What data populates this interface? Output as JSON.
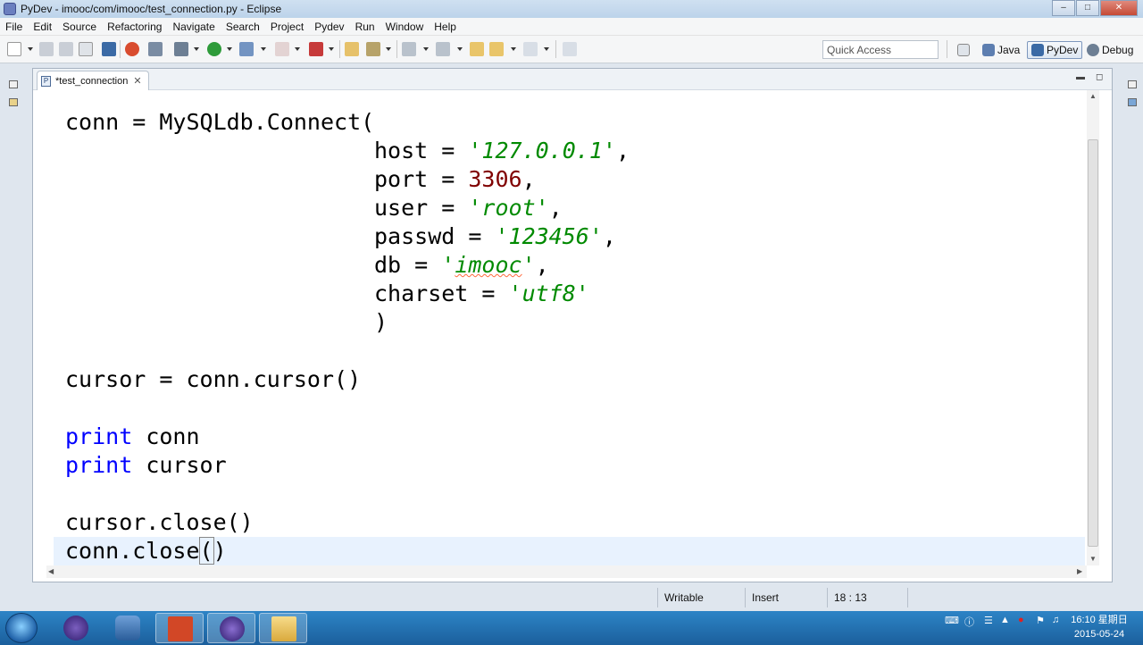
{
  "window": {
    "title": "PyDev - imooc/com/imooc/test_connection.py - Eclipse"
  },
  "menu": [
    "File",
    "Edit",
    "Source",
    "Refactoring",
    "Navigate",
    "Search",
    "Project",
    "Pydev",
    "Run",
    "Window",
    "Help"
  ],
  "toolbar": {
    "quick_access_placeholder": "Quick Access",
    "perspectives": [
      {
        "label": "Java",
        "icon": "java-perspective-icon"
      },
      {
        "label": "PyDev",
        "icon": "pydev-perspective-icon",
        "active": true
      },
      {
        "label": "Debug",
        "icon": "debug-perspective-icon"
      }
    ]
  },
  "editor": {
    "tab_label": "*test_connection",
    "file_icon_letter": "P",
    "code": {
      "l1": "conn = MySQLdb.Connect(",
      "host_key": "host = ",
      "host_val": "'127.0.0.1'",
      "comma": ",",
      "port_key": "port = ",
      "port_val": "3306",
      "user_key": "user = ",
      "user_val": "'root'",
      "passwd_key": "passwd = ",
      "passwd_val": "'123456'",
      "db_key": "db = ",
      "db_q1": "'",
      "db_val": "imooc",
      "db_q2": "'",
      "charset_key": "charset = ",
      "charset_val": "'utf8'",
      "close_paren": ")",
      "cursor_line": "cursor = conn.cursor()",
      "print_kw": "print",
      "print_conn": " conn",
      "print_cursor": " cursor",
      "cursor_close": "cursor.close()",
      "conn_close_a": "conn.close",
      "conn_close_b": "(",
      "conn_close_c": ")"
    }
  },
  "status": {
    "writable": "Writable",
    "insert": "Insert",
    "position": "18 : 13"
  },
  "taskbar": {
    "clock_time": "16:10 星期日",
    "clock_date": "2015-05-24"
  },
  "colors": {
    "keyword": "#0000ff",
    "string": "#008a00",
    "number": "#800000",
    "current_line": "#e8f2fe"
  }
}
